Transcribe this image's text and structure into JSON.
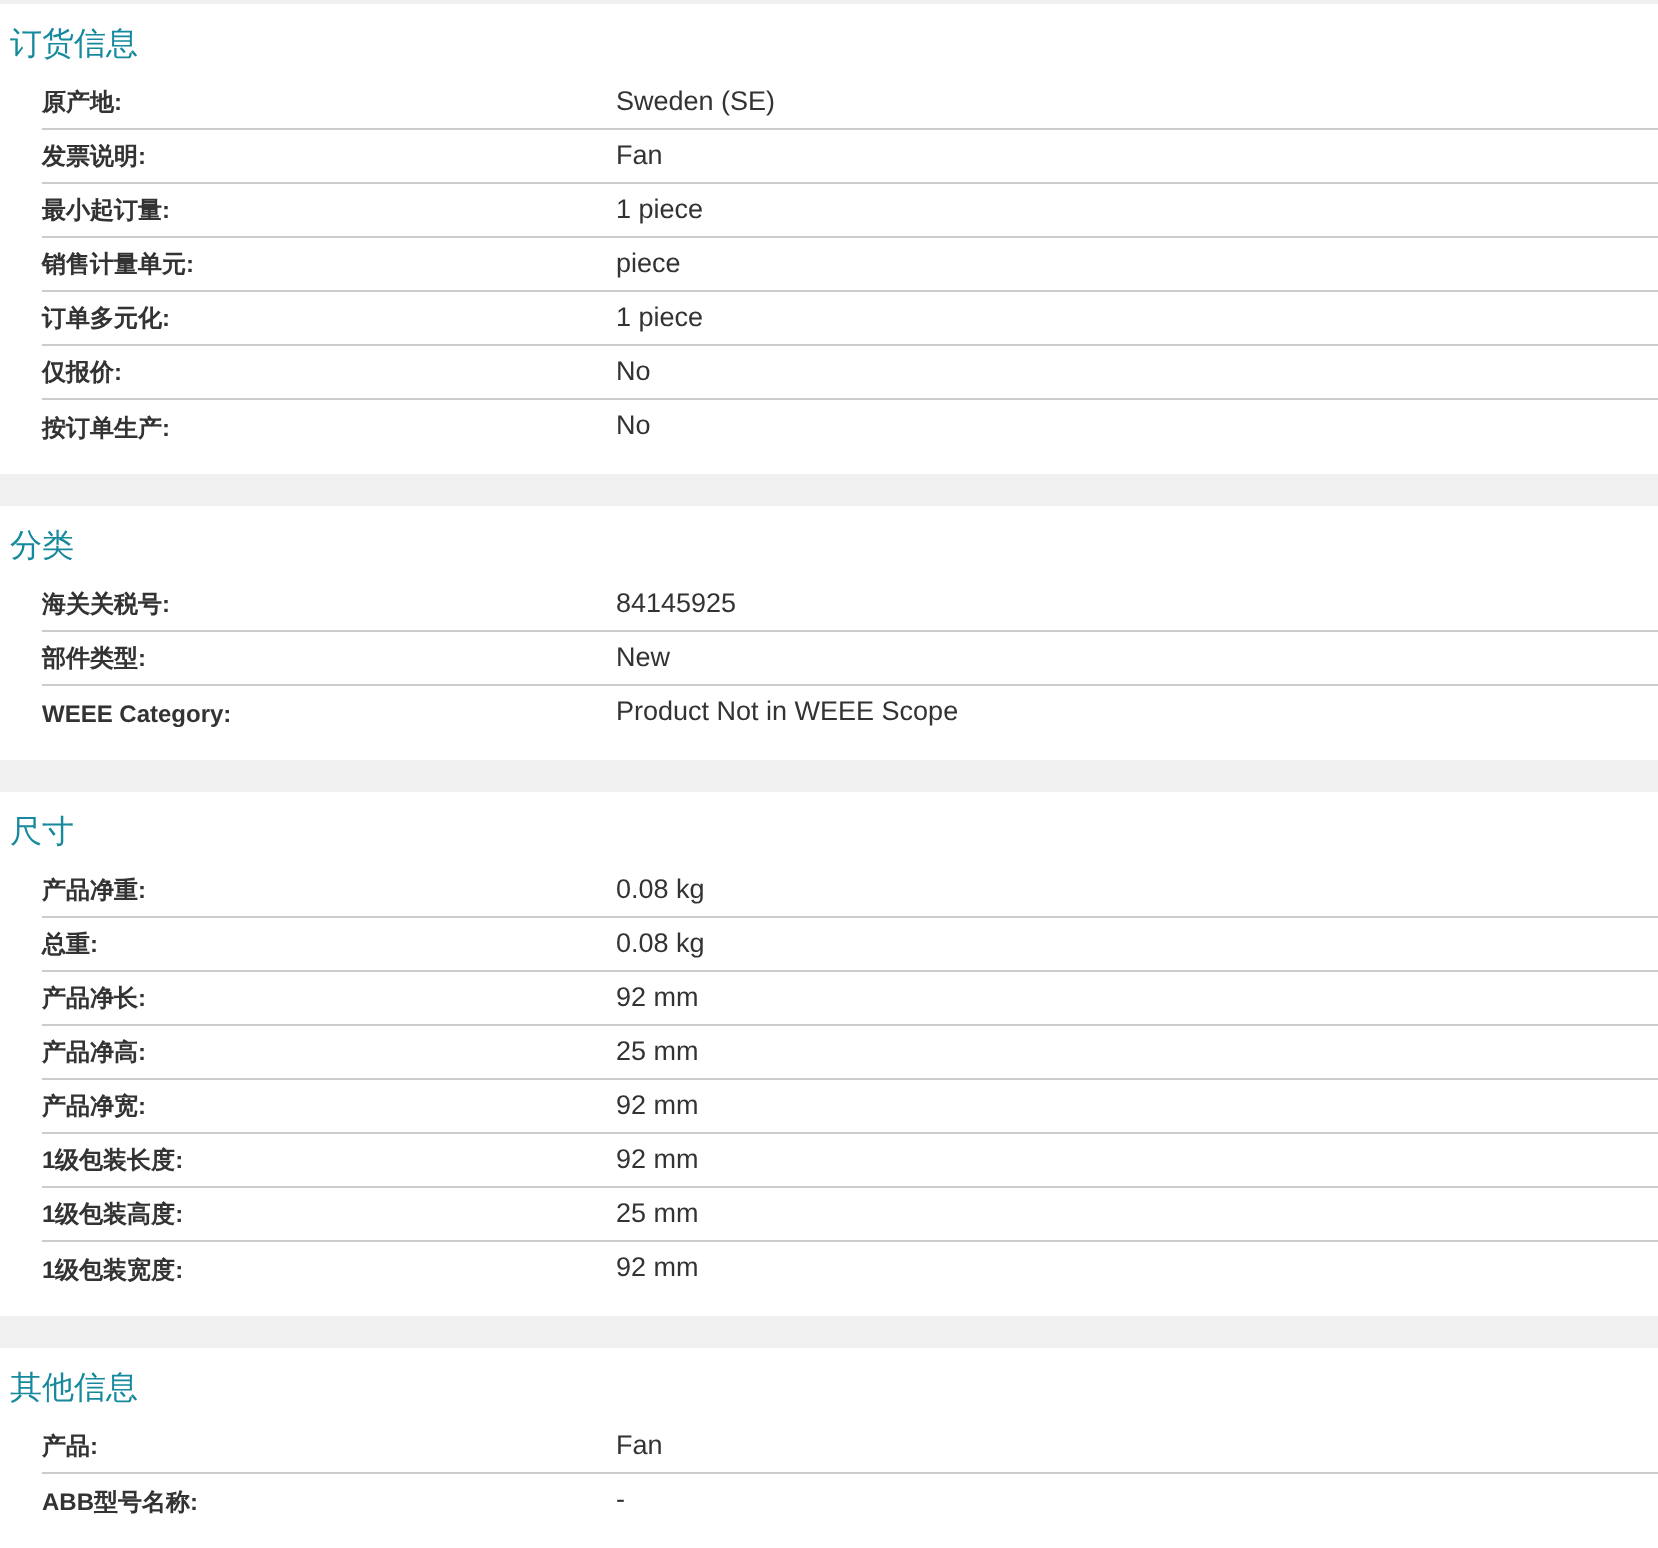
{
  "sections": [
    {
      "title": "订货信息",
      "rows": [
        {
          "label": "原产地:",
          "value": "Sweden (SE)"
        },
        {
          "label": "发票说明:",
          "value": "Fan"
        },
        {
          "label": "最小起订量:",
          "value": "1 piece"
        },
        {
          "label": "销售计量单元:",
          "value": "piece"
        },
        {
          "label": "订单多元化:",
          "value": "1 piece"
        },
        {
          "label": "仅报价:",
          "value": "No"
        },
        {
          "label": "按订单生产:",
          "value": "No"
        }
      ]
    },
    {
      "title": "分类",
      "rows": [
        {
          "label": "海关关税号:",
          "value": "84145925"
        },
        {
          "label": "部件类型:",
          "value": "New"
        },
        {
          "label": "WEEE Category:",
          "value": "Product Not in WEEE Scope"
        }
      ]
    },
    {
      "title": "尺寸",
      "rows": [
        {
          "label": "产品净重:",
          "value": "0.08 kg"
        },
        {
          "label": "总重:",
          "value": "0.08 kg"
        },
        {
          "label": "产品净长:",
          "value": "92 mm"
        },
        {
          "label": "产品净高:",
          "value": "25 mm"
        },
        {
          "label": "产品净宽:",
          "value": "92 mm"
        },
        {
          "label": "1级包装长度:",
          "value": "92 mm"
        },
        {
          "label": "1级包装高度:",
          "value": "25 mm"
        },
        {
          "label": "1级包装宽度:",
          "value": "92 mm"
        }
      ]
    },
    {
      "title": "其他信息",
      "rows": [
        {
          "label": "产品:",
          "value": "Fan"
        },
        {
          "label": "ABB型号名称:",
          "value": "-"
        }
      ]
    }
  ]
}
